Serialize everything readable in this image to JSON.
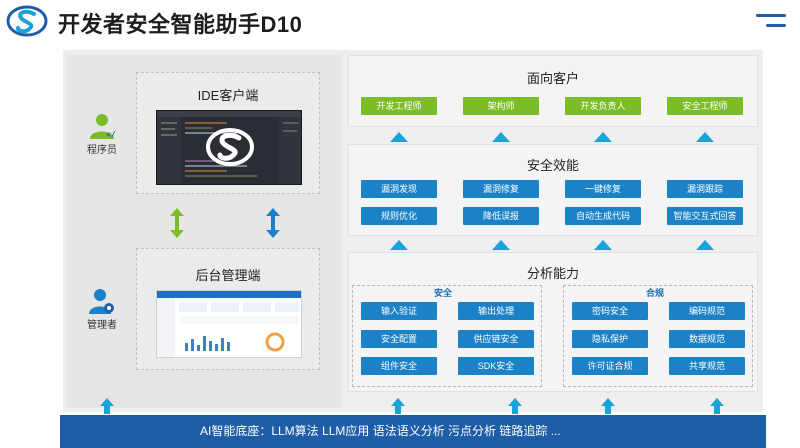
{
  "header": {
    "title": "开发者安全智能助手D10"
  },
  "left": {
    "ide_client": "IDE客户端",
    "admin_backend": "后台管理端",
    "roles": [
      {
        "label": "程序员",
        "icon": "programmer-icon"
      },
      {
        "label": "管理者",
        "icon": "admin-gear-icon"
      }
    ]
  },
  "customers": {
    "title": "面向客户",
    "items": [
      "开发工程师",
      "架构师",
      "开发负责人",
      "安全工程师"
    ]
  },
  "efficiency": {
    "title": "安全效能",
    "row1": [
      "漏洞发现",
      "漏洞修复",
      "一键修复",
      "漏洞跟踪"
    ],
    "row2": [
      "规则优化",
      "降低误报",
      "自动生成代码",
      "智能交互式回答"
    ]
  },
  "analysis": {
    "title": "分析能力",
    "security": {
      "title": "安全",
      "items": [
        "输入验证",
        "输出处理",
        "安全配置",
        "供应链安全",
        "组件安全",
        "SDK安全"
      ]
    },
    "compliance": {
      "title": "合规",
      "items": [
        "密码安全",
        "编码规范",
        "隐私保护",
        "数据规范",
        "许可证合规",
        "共享规范"
      ]
    }
  },
  "foundation": {
    "text": "AI智能底座：LLM算法 LLM应用 语法语义分析 污点分析 链路追踪 ..."
  },
  "colors": {
    "green": "#7cbd25",
    "blue": "#1c82c7",
    "navy": "#1e5ea8",
    "teal": "#1aa3d9"
  }
}
